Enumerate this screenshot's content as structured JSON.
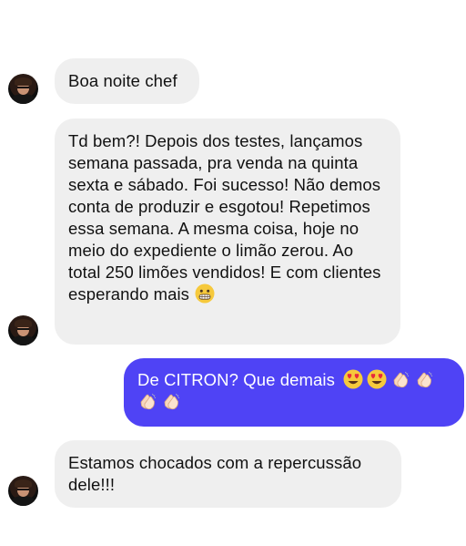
{
  "colors": {
    "incoming_bubble": "#efefef",
    "outgoing_bubble": "#4f43f5",
    "incoming_text": "#111111",
    "outgoing_text": "#ffffff"
  },
  "messages": [
    {
      "sender": "other",
      "text": "Boa noite chef",
      "emojis": []
    },
    {
      "sender": "other",
      "text": "Td bem?! Depois dos testes, lançamos semana passada, pra venda na quinta sexta e sábado. Foi sucesso! Não demos conta de produzir e esgotou! Repetimos essa semana. A mesma coisa, hoje no meio do expediente o limão zerou. Ao total 250 limões vendidos! E com clientes esperando mais",
      "emojis": [
        "grimacing-face-emoji"
      ]
    },
    {
      "sender": "me",
      "text": "De CITRON? Que demais",
      "emojis": [
        "heart-eyes-emoji",
        "heart-eyes-emoji",
        "clapping-hands-emoji",
        "clapping-hands-emoji",
        "clapping-hands-emoji",
        "clapping-hands-emoji"
      ]
    },
    {
      "sender": "other",
      "text": "Estamos chocados com a repercussão dele!!!",
      "emojis": []
    }
  ]
}
